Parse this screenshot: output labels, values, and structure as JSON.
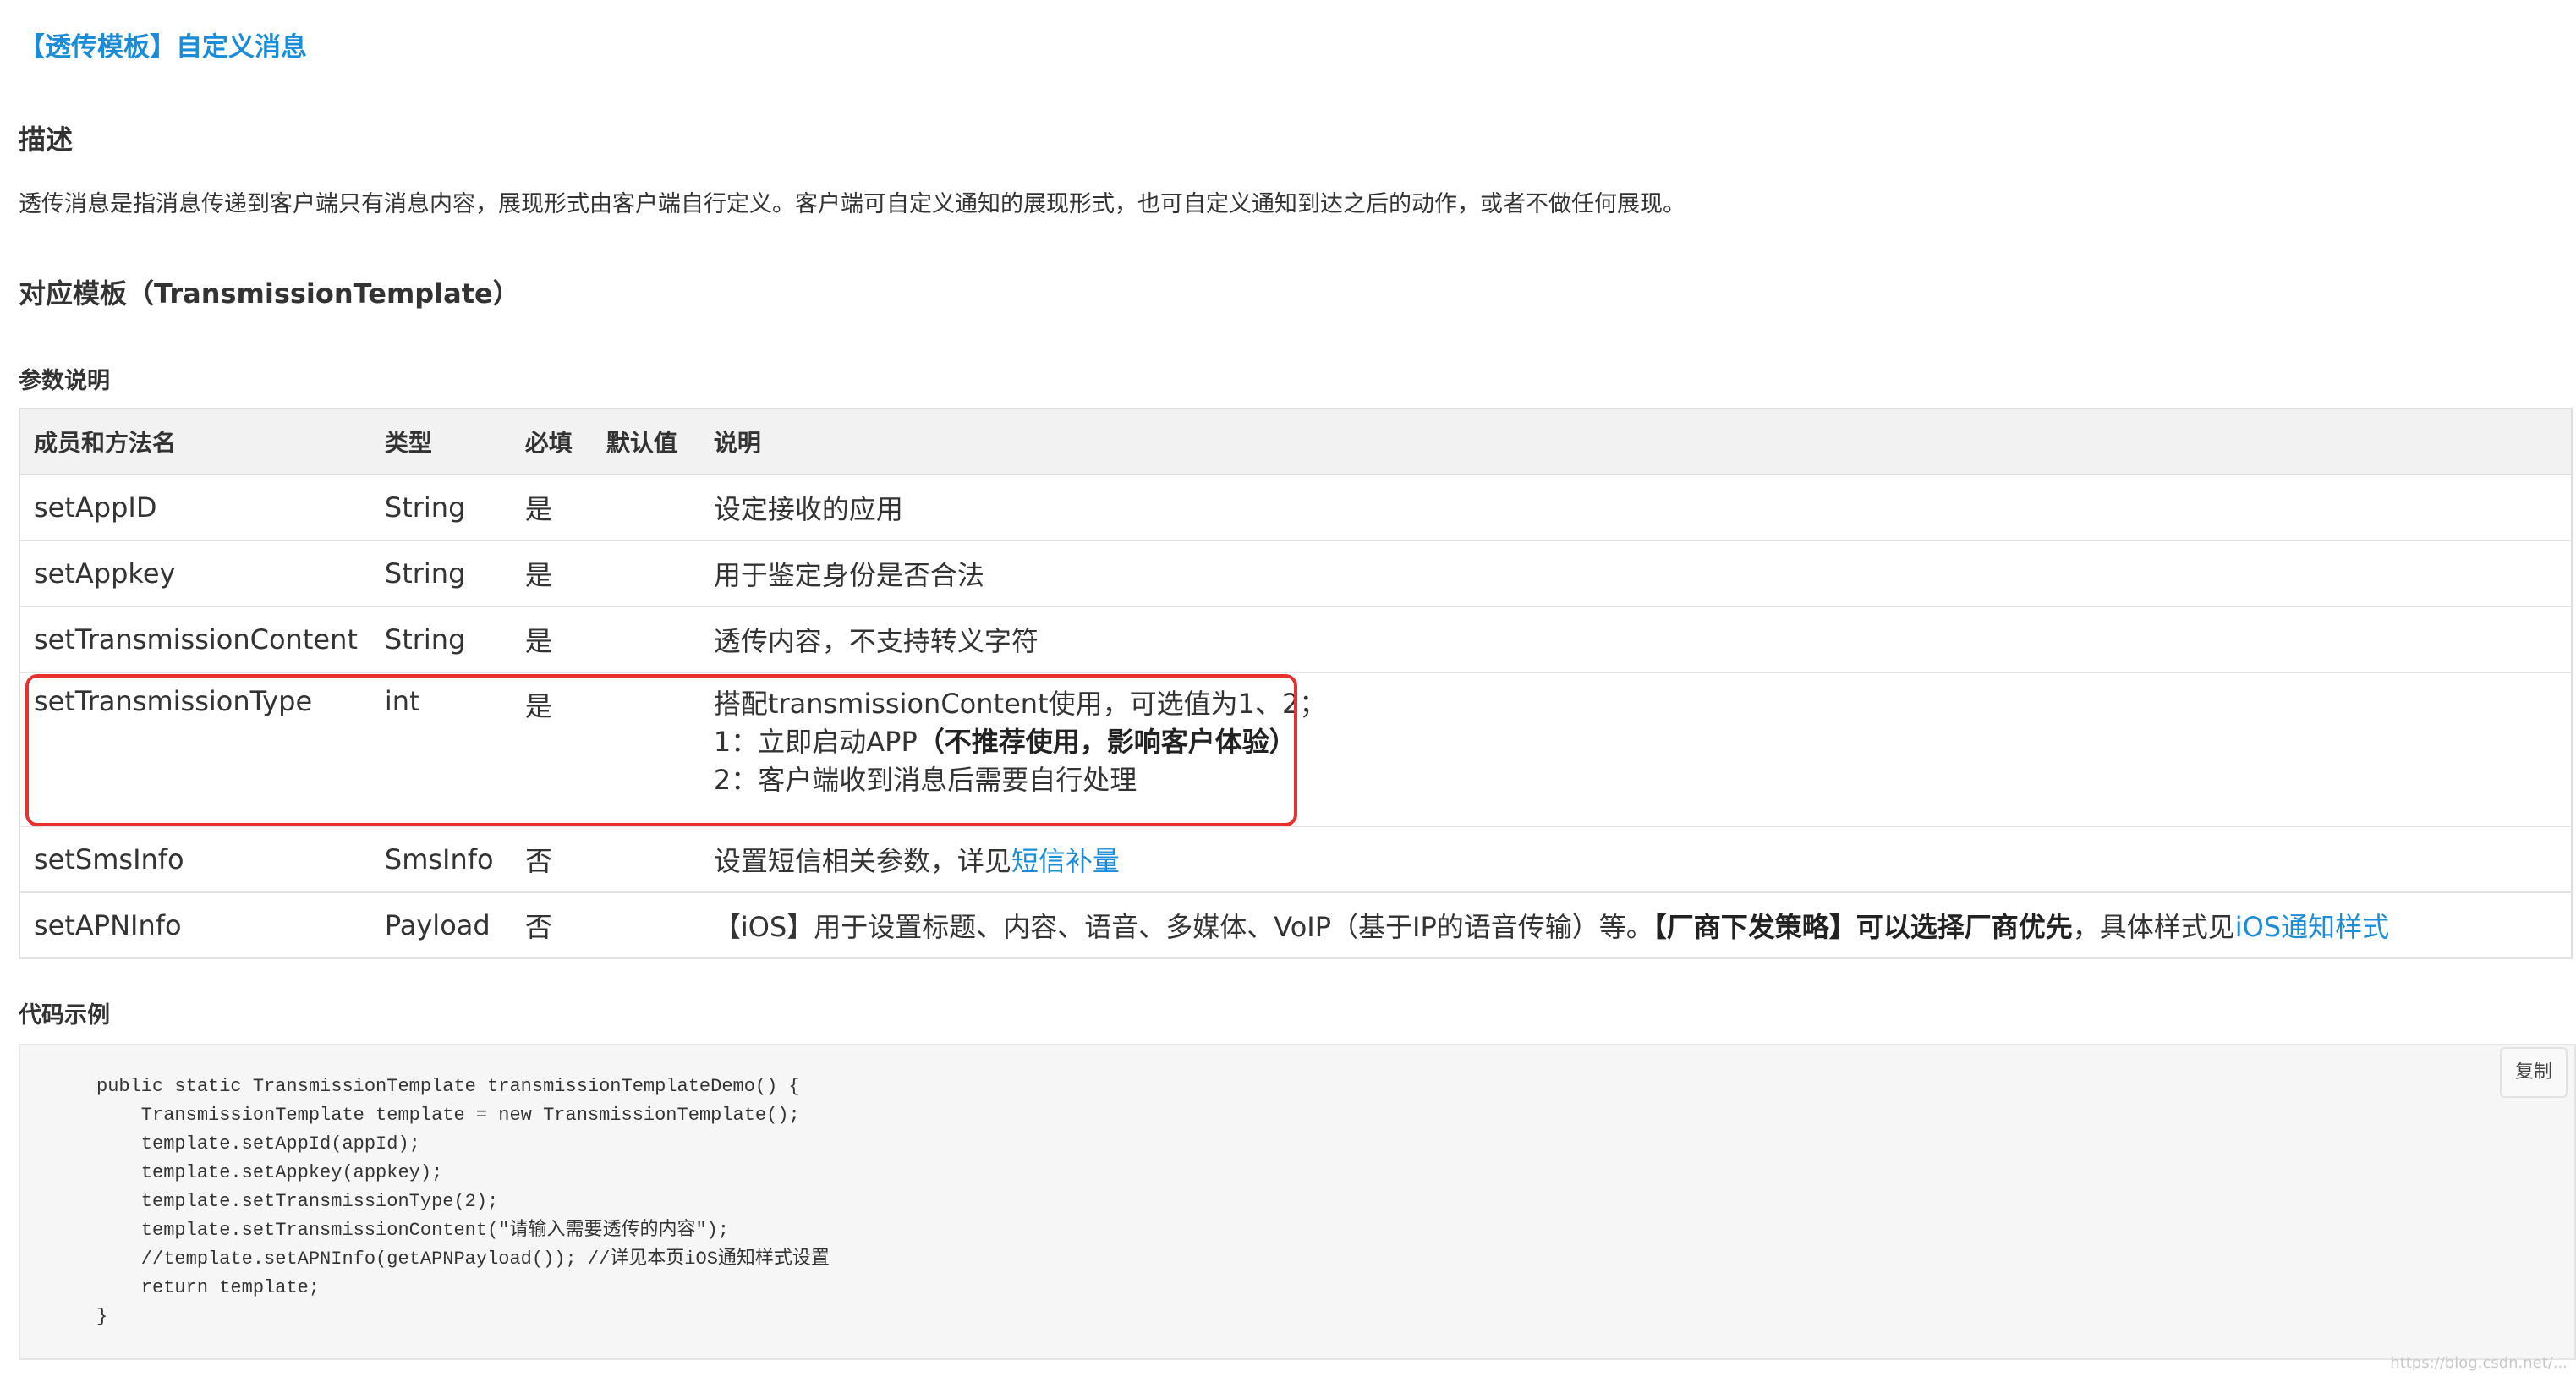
{
  "title_link": "【透传模板】自定义消息",
  "description": {
    "heading": "描述",
    "text": "透传消息是指消息传递到客户端只有消息内容，展现形式由客户端自行定义。客户端可自定义通知的展现形式，也可自定义通知到达之后的动作，或者不做任何展现。"
  },
  "template_heading": "对应模板（TransmissionTemplate）",
  "params_heading": "参数说明",
  "table": {
    "headers": [
      "成员和方法名",
      "类型",
      "必填",
      "默认值",
      "说明"
    ],
    "rows": [
      {
        "name": "setAppID",
        "type": "String",
        "required": "是",
        "default": "",
        "desc": "设定接收的应用"
      },
      {
        "name": "setAppkey",
        "type": "String",
        "required": "是",
        "default": "",
        "desc": "用于鉴定身份是否合法"
      },
      {
        "name": "setTransmissionContent",
        "type": "String",
        "required": "是",
        "default": "",
        "desc": "透传内容，不支持转义字符"
      },
      {
        "name": "setTransmissionType",
        "type": "int",
        "required": "是",
        "default": "",
        "desc_line1": "搭配transmissionContent使用，可选值为1、2；",
        "desc_line2_prefix": "1：立即启动APP",
        "desc_line2_bold": "（不推荐使用，影响客户体验）",
        "desc_line3": "2：客户端收到消息后需要自行处理"
      },
      {
        "name": "setSmsInfo",
        "type": "SmsInfo",
        "required": "否",
        "default": "",
        "desc_prefix": "设置短信相关参数，详见",
        "desc_link": "短信补量"
      },
      {
        "name": "setAPNInfo",
        "type": "Payload",
        "required": "否",
        "default": "",
        "desc_prefix": "【iOS】用于设置标题、内容、语音、多媒体、VoIP（基于IP的语音传输）等。",
        "desc_bold": "【厂商下发策略】可以选择厂商优先",
        "desc_mid": "，具体样式见",
        "desc_link": "iOS通知样式"
      }
    ]
  },
  "code_heading": "代码示例",
  "copy_label": "复制",
  "code": "public static TransmissionTemplate transmissionTemplateDemo() {\n    TransmissionTemplate template = new TransmissionTemplate();\n    template.setAppId(appId);\n    template.setAppkey(appkey);\n    template.setTransmissionType(2);\n    template.setTransmissionContent(\"请输入需要透传的内容\");\n    //template.setAPNInfo(getAPNPayload()); //详见本页iOS通知样式设置\n    return template;\n}",
  "watermark": "https://blog.csdn.net/...",
  "colors": {
    "link": "#1a8cd8",
    "highlight": "#e8302e",
    "header_bg": "#f2f2f2",
    "code_bg": "#f6f6f6"
  }
}
